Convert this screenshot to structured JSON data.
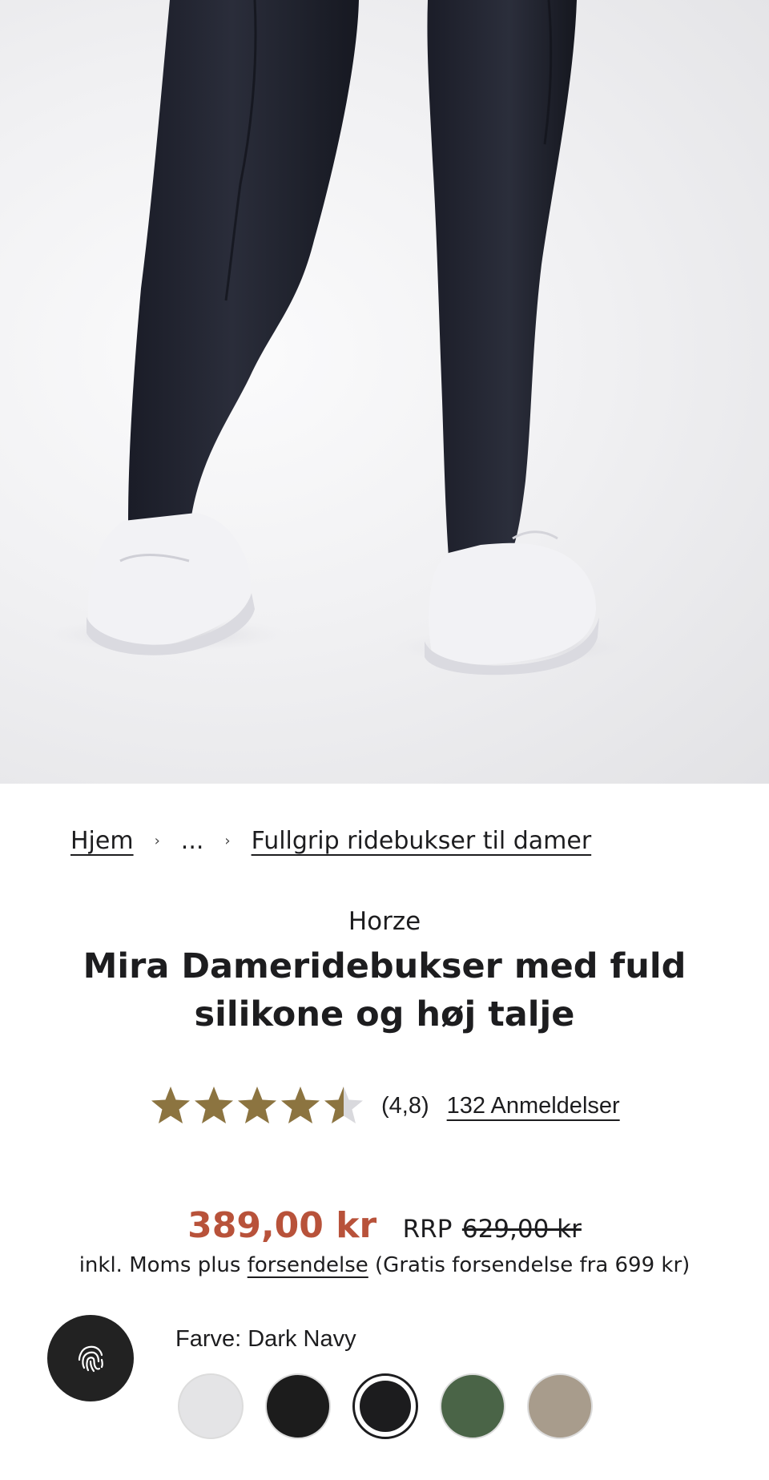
{
  "product_image": {
    "alt": "Horze Mira Dameridebukser – Dark Navy"
  },
  "breadcrumb": {
    "home": "Hjem",
    "ellipsis": "...",
    "category": "Fullgrip ridebukser til damer",
    "separator": "›"
  },
  "product": {
    "brand": "Horze",
    "title": "Mira Dameridebukser med fuld silikone og høj talje"
  },
  "rating": {
    "value": 4.8,
    "max": 5,
    "score_text": "(4,8)",
    "reviews_text": "132  Anmeldelser",
    "star_color": "#8c7440",
    "star_empty_color": "#d9d9dd"
  },
  "price": {
    "sale": "389,00 kr",
    "rrp_label": "RRP",
    "original": "629,00 kr",
    "sale_color": "#b8523a"
  },
  "vat": {
    "prefix": "inkl. Moms plus",
    "shipping_link": "forsendelse",
    "suffix": "(Gratis forsendelse fra 699 kr)"
  },
  "fingerprint_button": {
    "icon": "fingerprint-icon"
  },
  "color": {
    "label": "Farve: Dark Navy",
    "swatches": [
      {
        "name": "White",
        "hex": "#e4e4e6"
      },
      {
        "name": "Black",
        "hex": "#1c1c1c"
      },
      {
        "name": "Dark Navy",
        "hex": "#1c1c1e",
        "selected": true
      },
      {
        "name": "Green",
        "hex": "#4a6447"
      },
      {
        "name": "Beige",
        "hex": "#a89c8c"
      }
    ]
  }
}
